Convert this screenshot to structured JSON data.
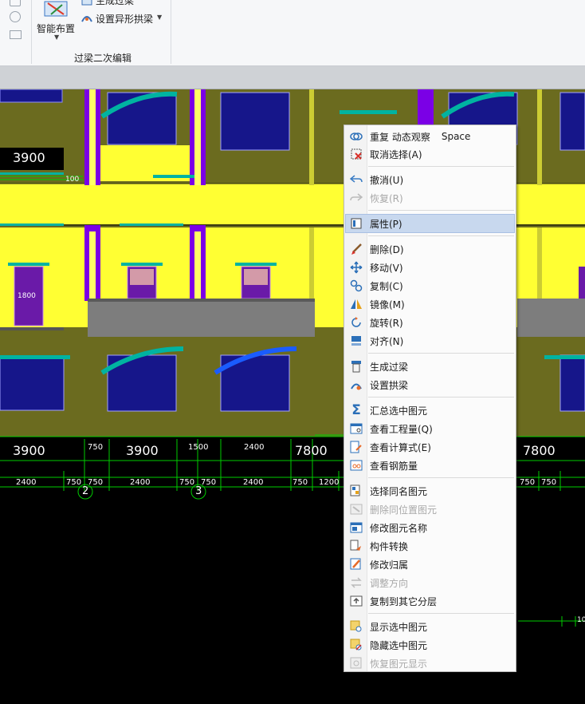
{
  "ribbon": {
    "smart_layout": "智能布置",
    "generate_lintel_partial": "生成过梁",
    "set_arch_beam": "设置异形拱梁",
    "group_label": "过梁二次编辑"
  },
  "drawing": {
    "dims_row1": [
      "3900",
      "750",
      "3900",
      "1500",
      "2400",
      "7800",
      "7800"
    ],
    "dims_row2": [
      "2400",
      "750",
      "750",
      "2400",
      "750",
      "750",
      "2400",
      "750",
      "1200",
      "750",
      "750"
    ],
    "axis_labels": [
      "2",
      "3"
    ],
    "label_3900_top": "3900",
    "label_100": "100",
    "label_1800": "1800",
    "label_10": "10"
  },
  "menu": {
    "items": [
      {
        "label": "重复 动态观察",
        "shortcut": "Space",
        "icon": "orbit-icon",
        "enabled": true
      },
      {
        "label": "取消选择(A)",
        "icon": "cancel-select-icon",
        "enabled": true
      },
      {
        "label": "撤消(U)",
        "icon": "undo-icon",
        "enabled": true
      },
      {
        "label": "恢复(R)",
        "icon": "redo-icon",
        "enabled": false
      },
      {
        "label": "属性(P)",
        "icon": "properties-icon",
        "enabled": true,
        "selected": true
      },
      {
        "label": "删除(D)",
        "icon": "delete-icon",
        "enabled": true
      },
      {
        "label": "移动(V)",
        "icon": "move-icon",
        "enabled": true
      },
      {
        "label": "复制(C)",
        "icon": "copy-icon",
        "enabled": true
      },
      {
        "label": "镜像(M)",
        "icon": "mirror-icon",
        "enabled": true
      },
      {
        "label": "旋转(R)",
        "icon": "rotate-icon",
        "enabled": true
      },
      {
        "label": "对齐(N)",
        "icon": "align-icon",
        "enabled": true
      },
      {
        "label": "生成过梁",
        "icon": "generate-lintel-icon",
        "enabled": true
      },
      {
        "label": "设置拱梁",
        "icon": "arch-beam-icon",
        "enabled": true
      },
      {
        "label": "汇总选中图元",
        "icon": "sum-icon",
        "enabled": true
      },
      {
        "label": "查看工程量(Q)",
        "icon": "quantity-icon",
        "enabled": true
      },
      {
        "label": "查看计算式(E)",
        "icon": "formula-icon",
        "enabled": true
      },
      {
        "label": "查看钢筋量",
        "icon": "rebar-icon",
        "enabled": true
      },
      {
        "label": "选择同名图元",
        "icon": "select-same-icon",
        "enabled": true
      },
      {
        "label": "删除同位置图元",
        "icon": "delete-same-pos-icon",
        "enabled": false
      },
      {
        "label": "修改图元名称",
        "icon": "rename-icon",
        "enabled": true
      },
      {
        "label": "构件转换",
        "icon": "convert-icon",
        "enabled": true
      },
      {
        "label": "修改归属",
        "icon": "change-owner-icon",
        "enabled": true
      },
      {
        "label": "调整方向",
        "icon": "adjust-direction-icon",
        "enabled": false
      },
      {
        "label": "复制到其它分层",
        "icon": "copy-layer-icon",
        "enabled": true
      },
      {
        "label": "显示选中图元",
        "icon": "show-selected-icon",
        "enabled": true
      },
      {
        "label": "隐藏选中图元",
        "icon": "hide-selected-icon",
        "enabled": true
      },
      {
        "label": "恢复图元显示",
        "icon": "restore-display-icon",
        "enabled": false
      }
    ]
  },
  "colors": {
    "wall_yellow": "#ffff33",
    "background_olive": "#6b6b1f",
    "column_purple": "#7b00e6",
    "window_blue": "#16168a",
    "arch_cyan": "#00b3a1",
    "arch_selected_blue": "#1a5cff",
    "slab_gray": "#7d7d7d",
    "dim_green": "#00cc00",
    "menu_selected": "#c8d8ee"
  }
}
